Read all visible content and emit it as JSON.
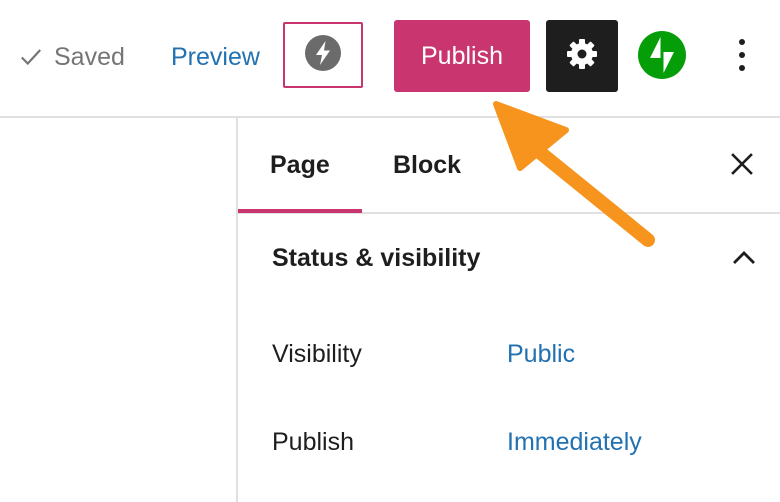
{
  "toolbar": {
    "saved_label": "Saved",
    "preview_label": "Preview",
    "amp_icon": "bolt-icon",
    "publish_label": "Publish",
    "settings_icon": "gear-icon",
    "jetpack_icon": "jetpack-icon",
    "more_icon": "more-vertical-icon"
  },
  "sidebar": {
    "tabs": [
      {
        "label": "Page",
        "active": true
      },
      {
        "label": "Block",
        "active": false
      }
    ],
    "close_icon": "close-icon",
    "panel": {
      "title": "Status & visibility",
      "expanded": true,
      "rows": [
        {
          "label": "Visibility",
          "value": "Public"
        },
        {
          "label": "Publish",
          "value": "Immediately"
        }
      ]
    }
  },
  "annotation": {
    "type": "arrow",
    "points_to": "publish-button",
    "color": "#f7941d"
  },
  "colors": {
    "accent": "#c9356e",
    "link": "#2271b1",
    "jetpack": "#069e08",
    "dark": "#1e1e1e",
    "muted": "#757575",
    "border": "#e0e0e0"
  }
}
